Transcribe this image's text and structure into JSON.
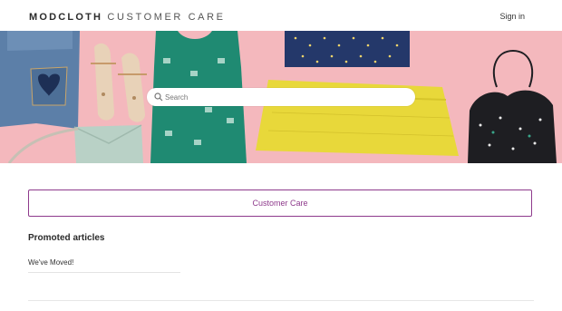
{
  "header": {
    "brand_primary": "MODCLOTH",
    "brand_secondary": "CUSTOMER CARE",
    "signin_label": "Sign in"
  },
  "hero": {
    "background_color": "#f4b8bd",
    "search": {
      "placeholder": "Search",
      "value": "",
      "icon": "search-icon"
    }
  },
  "categories": {
    "items": [
      {
        "label": "Customer Care"
      }
    ],
    "accent_color": "#8e3a8c"
  },
  "promoted": {
    "title": "Promoted articles",
    "articles": [
      {
        "title": "We've Moved!"
      }
    ]
  }
}
